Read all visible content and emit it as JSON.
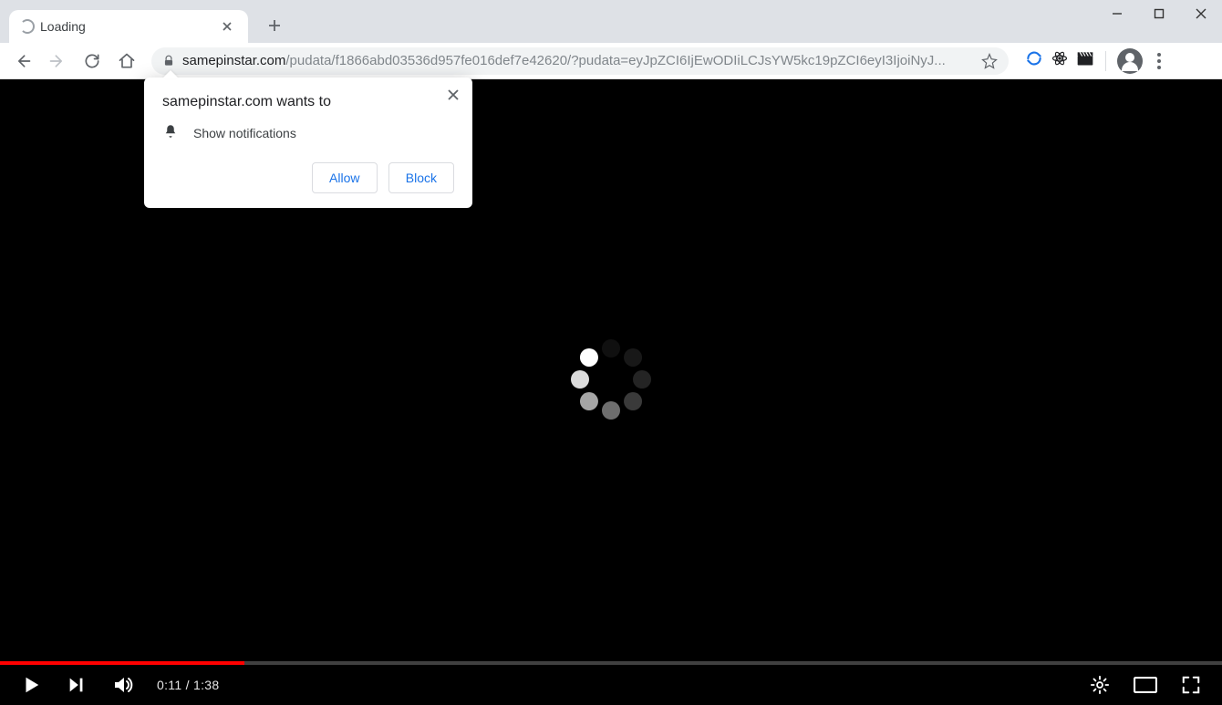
{
  "tab": {
    "title": "Loading"
  },
  "url": {
    "host": "samepinstar.com",
    "path": "/pudata/f1866abd03536d957fe016def7e42620/?pudata=eyJpZCI6IjEwODIiLCJsYW5kc19pZCI6eyI3IjoiNyJ..."
  },
  "player": {
    "current": "0:11",
    "duration": "1:38"
  },
  "permission": {
    "title": "samepinstar.com wants to",
    "item": "Show notifications",
    "allow": "Allow",
    "block": "Block"
  }
}
